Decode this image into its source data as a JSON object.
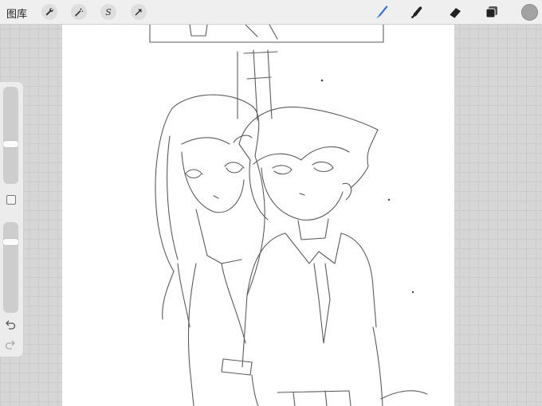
{
  "toolbar": {
    "gallery_label": "图库",
    "left_tools": [
      {
        "name": "wrench-icon"
      },
      {
        "name": "magic-wand-icon"
      },
      {
        "name": "selection-s-icon",
        "glyph": "S"
      },
      {
        "name": "transform-arrow-icon"
      }
    ],
    "right_tools": [
      {
        "name": "brush-icon",
        "active": true,
        "color": "#2f6fe0"
      },
      {
        "name": "smudge-icon"
      },
      {
        "name": "eraser-icon"
      },
      {
        "name": "layers-icon"
      }
    ],
    "current_color": "#a3a3a3"
  },
  "sidebar": {
    "brush_size": 0.4,
    "opacity": 0.8,
    "modify_button": "square-modify-icon",
    "undo": "undo-icon",
    "redo": "redo-icon"
  }
}
